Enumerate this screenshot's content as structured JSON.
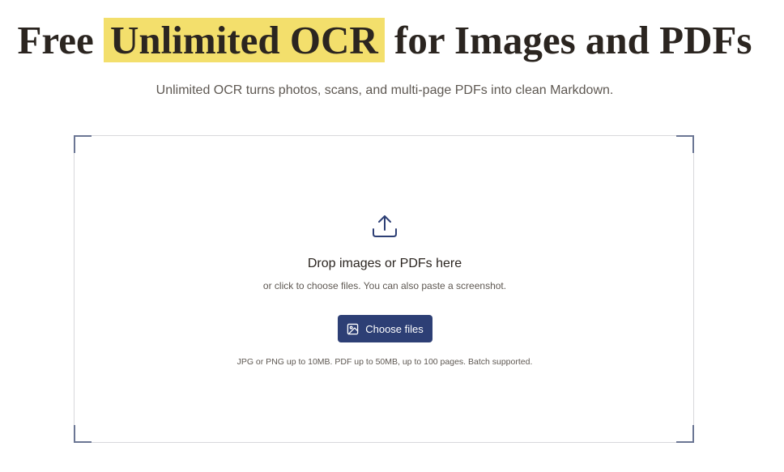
{
  "header": {
    "title_before": "Free",
    "title_highlight": "Unlimited OCR",
    "title_after": "for Images and PDFs",
    "subtitle": "Unlimited OCR turns photos, scans, and multi-page PDFs into clean Markdown.",
    "highlight_color": "#f3df6c"
  },
  "dropzone": {
    "icon": "upload-icon",
    "title": "Drop images or PDFs here",
    "subtitle": "or click to choose files. You can also paste a screenshot.",
    "button_label": "Choose files",
    "button_icon": "image-icon",
    "button_color": "#2d3f75",
    "note": "JPG or PNG up to 10MB. PDF up to 50MB, up to 100 pages. Batch supported."
  }
}
